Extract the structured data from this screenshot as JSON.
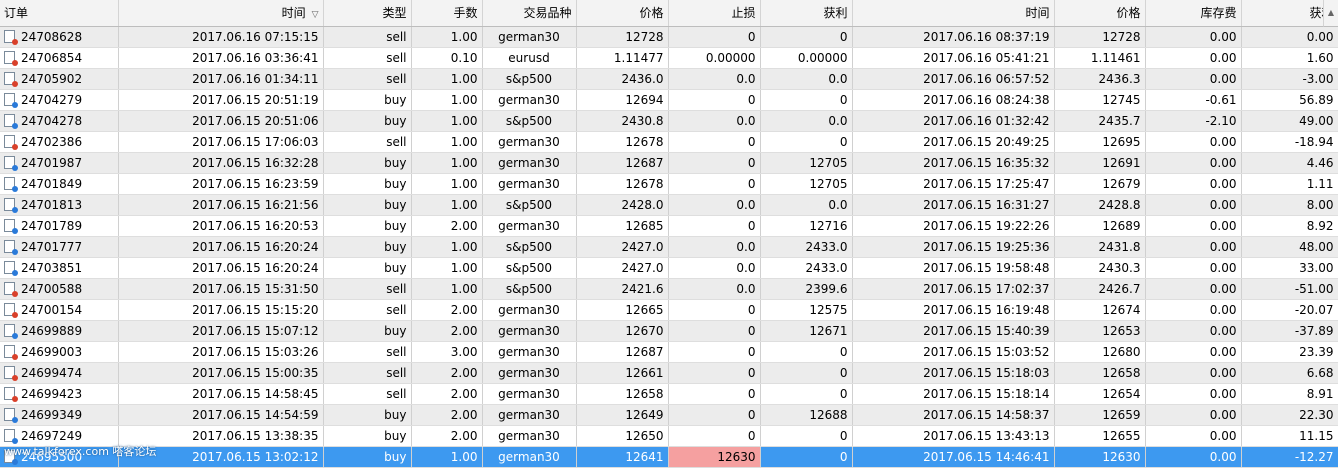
{
  "columns": [
    "订单",
    "时间",
    "类型",
    "手数",
    "交易品种",
    "价格",
    "止损",
    "获利",
    "时间",
    "价格",
    "库存费",
    "获利"
  ],
  "sort_indicator": "▽",
  "scroll_up_glyph": "▲",
  "watermark": "www.talkforex.com 嗒客论坛",
  "rows": [
    [
      "24708628",
      "2017.06.16 07:15:15",
      "sell",
      "1.00",
      "german30",
      "12728",
      "0",
      "0",
      "2017.06.16 08:37:19",
      "12728",
      "0.00",
      "0.00"
    ],
    [
      "24706854",
      "2017.06.16 03:36:41",
      "sell",
      "0.10",
      "eurusd",
      "1.11477",
      "0.00000",
      "0.00000",
      "2017.06.16 05:41:21",
      "1.11461",
      "0.00",
      "1.60"
    ],
    [
      "24705902",
      "2017.06.16 01:34:11",
      "sell",
      "1.00",
      "s&p500",
      "2436.0",
      "0.0",
      "0.0",
      "2017.06.16 06:57:52",
      "2436.3",
      "0.00",
      "-3.00"
    ],
    [
      "24704279",
      "2017.06.15 20:51:19",
      "buy",
      "1.00",
      "german30",
      "12694",
      "0",
      "0",
      "2017.06.16 08:24:38",
      "12745",
      "-0.61",
      "56.89"
    ],
    [
      "24704278",
      "2017.06.15 20:51:06",
      "buy",
      "1.00",
      "s&p500",
      "2430.8",
      "0.0",
      "0.0",
      "2017.06.16 01:32:42",
      "2435.7",
      "-2.10",
      "49.00"
    ],
    [
      "24702386",
      "2017.06.15 17:06:03",
      "sell",
      "1.00",
      "german30",
      "12678",
      "0",
      "0",
      "2017.06.15 20:49:25",
      "12695",
      "0.00",
      "-18.94"
    ],
    [
      "24701987",
      "2017.06.15 16:32:28",
      "buy",
      "1.00",
      "german30",
      "12687",
      "0",
      "12705",
      "2017.06.15 16:35:32",
      "12691",
      "0.00",
      "4.46"
    ],
    [
      "24701849",
      "2017.06.15 16:23:59",
      "buy",
      "1.00",
      "german30",
      "12678",
      "0",
      "12705",
      "2017.06.15 17:25:47",
      "12679",
      "0.00",
      "1.11"
    ],
    [
      "24701813",
      "2017.06.15 16:21:56",
      "buy",
      "1.00",
      "s&p500",
      "2428.0",
      "0.0",
      "0.0",
      "2017.06.15 16:31:27",
      "2428.8",
      "0.00",
      "8.00"
    ],
    [
      "24701789",
      "2017.06.15 16:20:53",
      "buy",
      "2.00",
      "german30",
      "12685",
      "0",
      "12716",
      "2017.06.15 19:22:26",
      "12689",
      "0.00",
      "8.92"
    ],
    [
      "24701777",
      "2017.06.15 16:20:24",
      "buy",
      "1.00",
      "s&p500",
      "2427.0",
      "0.0",
      "2433.0",
      "2017.06.15 19:25:36",
      "2431.8",
      "0.00",
      "48.00"
    ],
    [
      "24703851",
      "2017.06.15 16:20:24",
      "buy",
      "1.00",
      "s&p500",
      "2427.0",
      "0.0",
      "2433.0",
      "2017.06.15 19:58:48",
      "2430.3",
      "0.00",
      "33.00"
    ],
    [
      "24700588",
      "2017.06.15 15:31:50",
      "sell",
      "1.00",
      "s&p500",
      "2421.6",
      "0.0",
      "2399.6",
      "2017.06.15 17:02:37",
      "2426.7",
      "0.00",
      "-51.00"
    ],
    [
      "24700154",
      "2017.06.15 15:15:20",
      "sell",
      "2.00",
      "german30",
      "12665",
      "0",
      "12575",
      "2017.06.15 16:19:48",
      "12674",
      "0.00",
      "-20.07"
    ],
    [
      "24699889",
      "2017.06.15 15:07:12",
      "buy",
      "2.00",
      "german30",
      "12670",
      "0",
      "12671",
      "2017.06.15 15:40:39",
      "12653",
      "0.00",
      "-37.89"
    ],
    [
      "24699003",
      "2017.06.15 15:03:26",
      "sell",
      "3.00",
      "german30",
      "12687",
      "0",
      "0",
      "2017.06.15 15:03:52",
      "12680",
      "0.00",
      "23.39"
    ],
    [
      "24699474",
      "2017.06.15 15:00:35",
      "sell",
      "2.00",
      "german30",
      "12661",
      "0",
      "0",
      "2017.06.15 15:18:03",
      "12658",
      "0.00",
      "6.68"
    ],
    [
      "24699423",
      "2017.06.15 14:58:45",
      "sell",
      "2.00",
      "german30",
      "12658",
      "0",
      "0",
      "2017.06.15 15:18:14",
      "12654",
      "0.00",
      "8.91"
    ],
    [
      "24699349",
      "2017.06.15 14:54:59",
      "buy",
      "2.00",
      "german30",
      "12649",
      "0",
      "12688",
      "2017.06.15 14:58:37",
      "12659",
      "0.00",
      "22.30"
    ],
    [
      "24697249",
      "2017.06.15 13:38:35",
      "buy",
      "2.00",
      "german30",
      "12650",
      "0",
      "0",
      "2017.06.15 13:43:13",
      "12655",
      "0.00",
      "11.15"
    ],
    [
      "24695500",
      "2017.06.15 13:02:12",
      "buy",
      "1.00",
      "german30",
      "12641",
      "12630",
      "0",
      "2017.06.15 14:46:41",
      "12630",
      "0.00",
      "-12.27"
    ]
  ],
  "selected_row_index": 20,
  "colors": {
    "selected_row": "#3d99f0",
    "highlight_stoploss": "#f5a0a0",
    "sell_icon": "#d9402a",
    "buy_icon": "#2a7ad9"
  }
}
